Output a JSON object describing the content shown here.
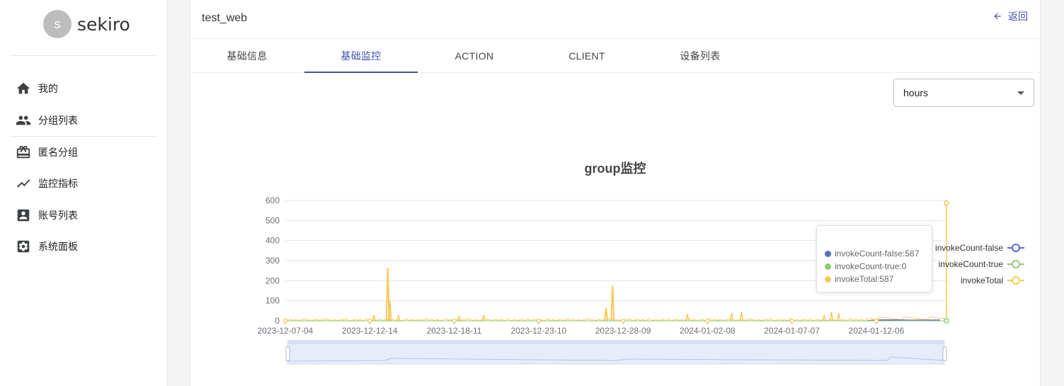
{
  "app": {
    "name": "sekiro",
    "avatar_letter": "s"
  },
  "sidebar": {
    "items": [
      {
        "label": "我的",
        "icon": "home-icon"
      },
      {
        "label": "分组列表",
        "icon": "people-icon"
      },
      {
        "label": "匿名分组",
        "icon": "gift-box-icon"
      },
      {
        "label": "监控指标",
        "icon": "trending-line-icon"
      },
      {
        "label": "账号列表",
        "icon": "account-box-icon"
      },
      {
        "label": "系统面板",
        "icon": "settings-panel-icon"
      }
    ]
  },
  "header": {
    "title": "test_web",
    "back_label": "返回"
  },
  "tabs": [
    {
      "label": "基础信息",
      "active": false
    },
    {
      "label": "基础监控",
      "active": true
    },
    {
      "label": "ACTION",
      "active": false
    },
    {
      "label": "CLIENT",
      "active": false
    },
    {
      "label": "设备列表",
      "active": false
    }
  ],
  "range_select": {
    "value": "hours"
  },
  "colors": {
    "accent": "#3f51b5",
    "invoke_false": "#5470c6",
    "invoke_true": "#91cc75",
    "invoke_total": "#fac858"
  },
  "tooltip": [
    {
      "text": "invokeCount-false:587"
    },
    {
      "text": "invokeCount-true:0"
    },
    {
      "text": "invokeTotal:587"
    }
  ],
  "chart_data": {
    "type": "line",
    "title": "group监控",
    "ylim": [
      0,
      600
    ],
    "y_ticks": [
      0,
      100,
      200,
      300,
      400,
      500,
      600
    ],
    "x_ticks": [
      "2023-12-07-04",
      "2023-12-12-14",
      "2023-12-18-11",
      "2023-12-23-10",
      "2023-12-28-09",
      "2024-01-02-08",
      "2024-01-07-07",
      "2024-01-12-06"
    ],
    "legend_position": "right",
    "grid": true,
    "x_fraction": [
      0.0,
      0.12,
      0.155,
      0.158,
      0.175,
      0.205,
      0.47,
      0.485,
      0.495,
      0.88,
      0.9,
      1.0
    ],
    "series": [
      {
        "name": "invokeCount-false",
        "values": [
          0,
          0,
          0,
          0,
          0,
          0,
          0,
          0,
          0,
          0,
          5,
          587
        ]
      },
      {
        "name": "invokeCount-true",
        "values": [
          0,
          0,
          0,
          0,
          0,
          0,
          0,
          0,
          0,
          0,
          0,
          0
        ]
      },
      {
        "name": "invokeTotal",
        "values": [
          0,
          10,
          265,
          100,
          45,
          75,
          95,
          65,
          175,
          20,
          80,
          587
        ]
      }
    ],
    "spikes": [
      {
        "x": 0.134,
        "v": 28
      },
      {
        "x": 0.171,
        "v": 30
      },
      {
        "x": 0.263,
        "v": 22
      },
      {
        "x": 0.3,
        "v": 30
      },
      {
        "x": 0.608,
        "v": 35
      },
      {
        "x": 0.675,
        "v": 40
      },
      {
        "x": 0.69,
        "v": 45
      },
      {
        "x": 0.815,
        "v": 30
      },
      {
        "x": 0.826,
        "v": 45
      },
      {
        "x": 0.837,
        "v": 38
      }
    ]
  }
}
